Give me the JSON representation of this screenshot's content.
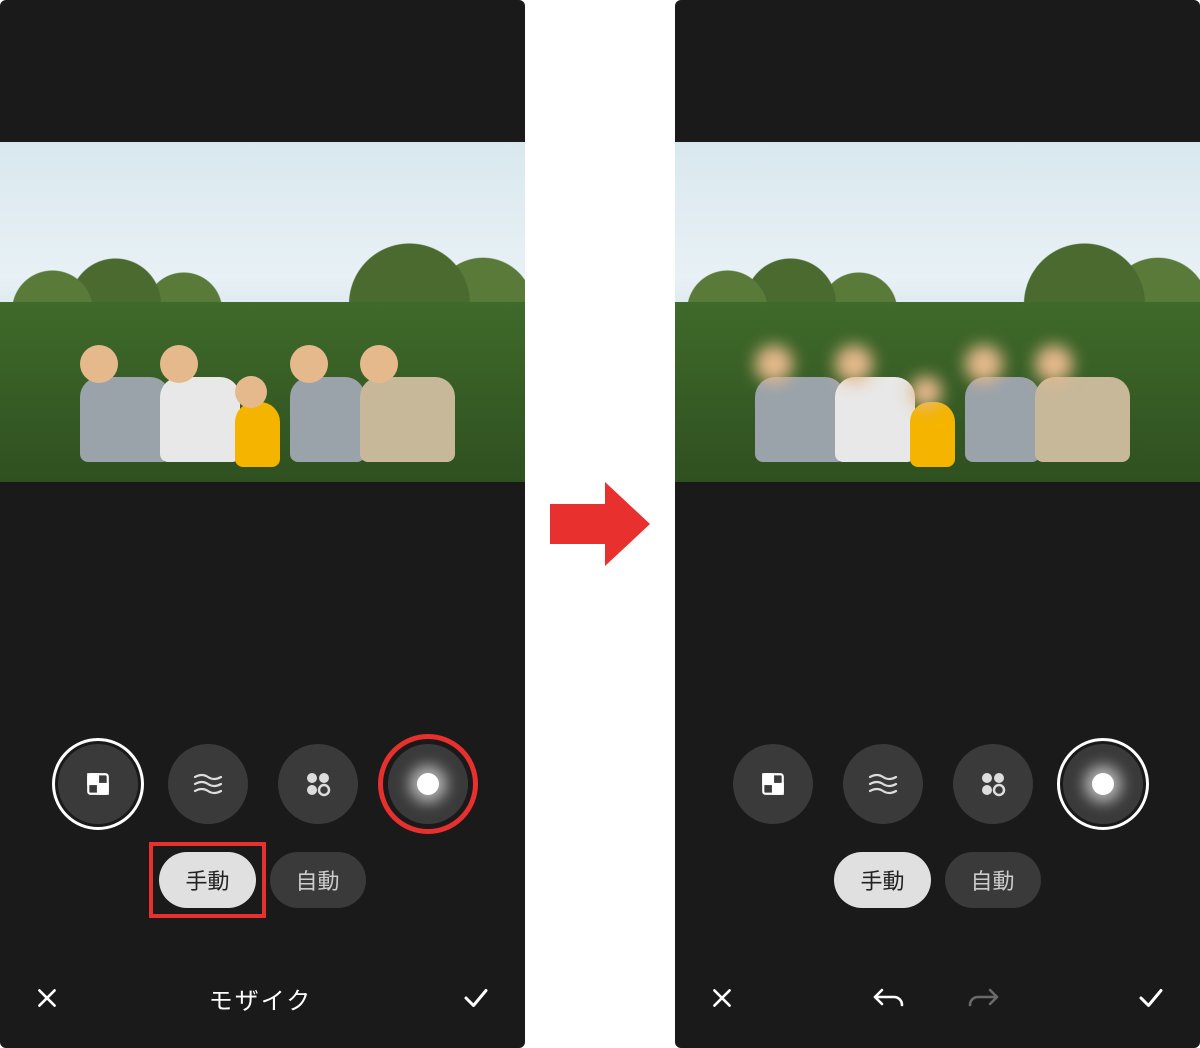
{
  "left": {
    "styles": [
      {
        "name": "pixel",
        "active": true,
        "annotated": false
      },
      {
        "name": "wave",
        "active": false,
        "annotated": false
      },
      {
        "name": "bubble",
        "active": false,
        "annotated": false
      },
      {
        "name": "blur",
        "active": false,
        "annotated": true
      }
    ],
    "modes": {
      "manual": "手動",
      "auto": "自動",
      "active": "manual",
      "manual_annotated": true
    },
    "bottom": {
      "title": "モザイク",
      "cancel": "×",
      "confirm": "✓"
    }
  },
  "right": {
    "styles": [
      {
        "name": "pixel",
        "active": false
      },
      {
        "name": "wave",
        "active": false
      },
      {
        "name": "bubble",
        "active": false
      },
      {
        "name": "blur",
        "active": true
      }
    ],
    "modes": {
      "manual": "手動",
      "auto": "自動",
      "active": "manual"
    },
    "bottom": {
      "cancel": "×",
      "confirm": "✓"
    },
    "faces_blurred": true
  }
}
